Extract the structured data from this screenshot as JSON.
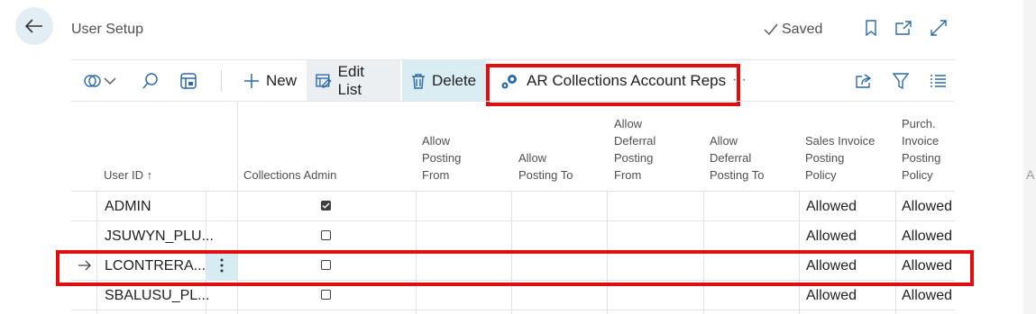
{
  "header": {
    "title": "User Setup",
    "saved_label": "Saved",
    "icons": [
      "back-arrow-icon",
      "bookmark-icon",
      "open-new-window-icon",
      "expand-icon"
    ]
  },
  "toolbar": {
    "new_label": "New",
    "edit_list_label": "Edit List",
    "delete_label": "Delete",
    "ar_label": "AR Collections Account Reps",
    "more_label": "···",
    "icons": [
      "views-icon",
      "chevron-down-icon",
      "search-icon",
      "analysis-icon",
      "share-icon",
      "filter-icon",
      "list-icon"
    ]
  },
  "table": {
    "columns": [
      {
        "key": "user_id",
        "label": "User ID ↑"
      },
      {
        "key": "collections_admin",
        "label": "Collections Admin"
      },
      {
        "key": "allow_from",
        "lines": [
          "Allow",
          "Posting",
          "From"
        ]
      },
      {
        "key": "allow_to",
        "lines": [
          "Allow",
          "Posting To"
        ]
      },
      {
        "key": "deferral_from",
        "lines": [
          "Allow",
          "Deferral",
          "Posting",
          "From"
        ]
      },
      {
        "key": "deferral_to",
        "lines": [
          "Allow",
          "Deferral",
          "Posting To"
        ]
      },
      {
        "key": "sales_policy",
        "lines": [
          "Sales Invoice",
          "Posting",
          "Policy"
        ]
      },
      {
        "key": "purch_policy",
        "lines": [
          "Purch.",
          "Invoice",
          "Posting",
          "Policy"
        ]
      }
    ],
    "rows": [
      {
        "user_id": "ADMIN",
        "collections_admin": true,
        "sales_policy": "Allowed",
        "purch_policy": "Allowed",
        "selected": false
      },
      {
        "user_id": "JSUWYN_PLU...",
        "collections_admin": false,
        "sales_policy": "Allowed",
        "purch_policy": "Allowed",
        "selected": false
      },
      {
        "user_id": "LCONTRERA...",
        "collections_admin": false,
        "sales_policy": "Allowed",
        "purch_policy": "Allowed",
        "selected": true
      },
      {
        "user_id": "SBALUSU_PL...",
        "collections_admin": false,
        "sales_policy": "Allowed",
        "purch_policy": "Allowed",
        "selected": false
      }
    ]
  },
  "colors": {
    "accent": "#e10d10",
    "selected_cell": "#d5ecf3",
    "back_button_bg": "#e3eef4"
  }
}
